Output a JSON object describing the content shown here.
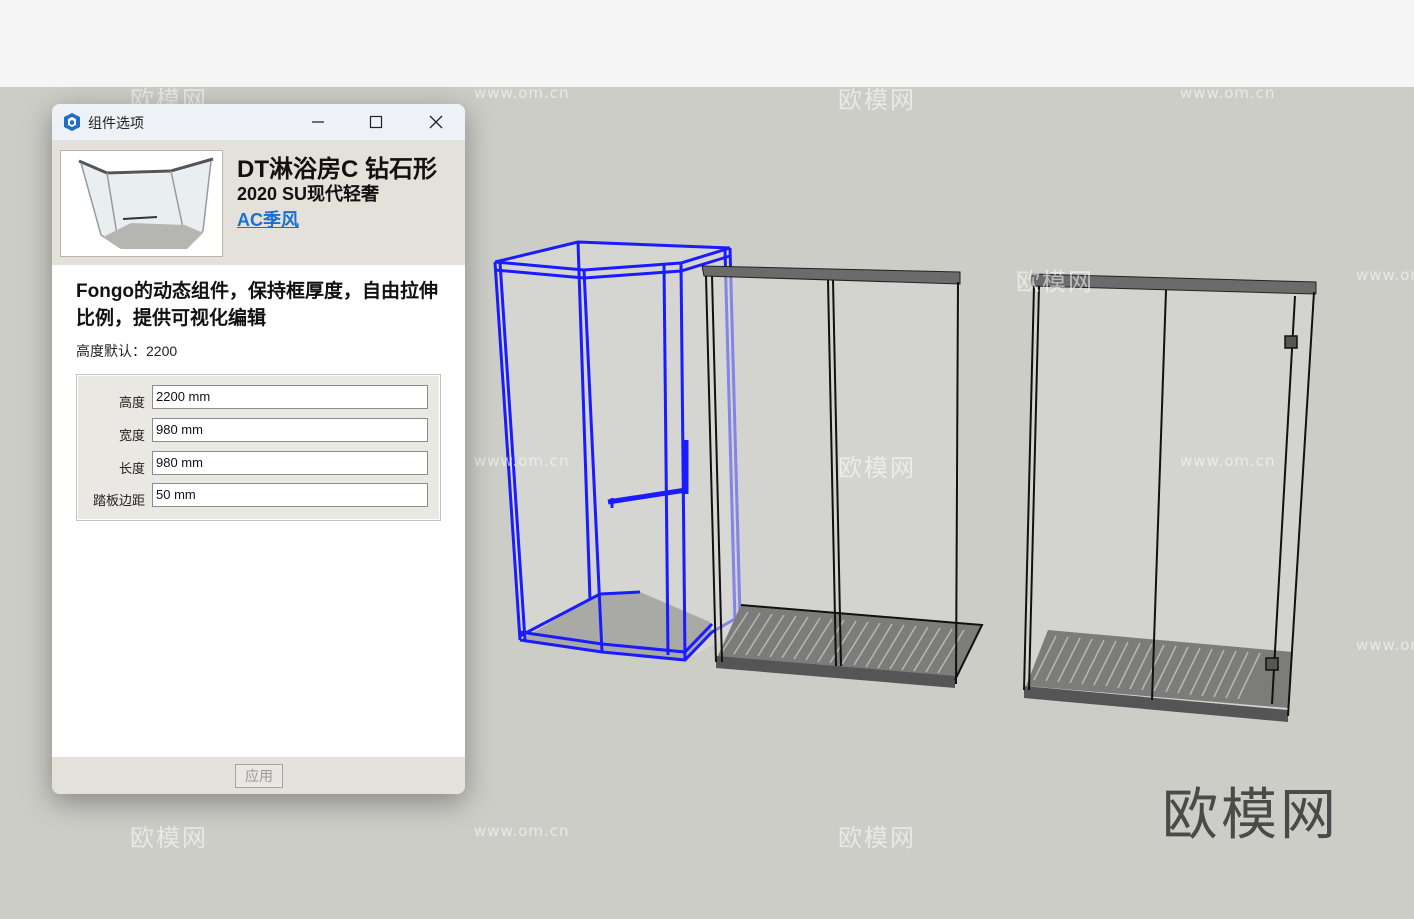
{
  "dialog": {
    "title": "组件选项",
    "component_name": "DT淋浴房C 钻石形",
    "subtitle": "2020 SU现代轻奢",
    "author": "AC季风",
    "description": "Fongo的动态组件，保持框厚度，自由拉伸比例，提供可视化编辑",
    "default_height": "高度默认：2200",
    "params": [
      {
        "label": "高度",
        "value": "2200 mm"
      },
      {
        "label": "宽度",
        "value": "980 mm"
      },
      {
        "label": "长度",
        "value": "980 mm"
      },
      {
        "label": "踏板边距",
        "value": "50 mm"
      }
    ],
    "apply_label": "应用"
  },
  "watermarks": {
    "text": "欧模网",
    "url": "www.om.cn"
  },
  "brand": "欧模网",
  "colors": {
    "viewport_bg": "#cdcdc7",
    "selection": "#1a1aff",
    "link": "#1a6fd1"
  }
}
